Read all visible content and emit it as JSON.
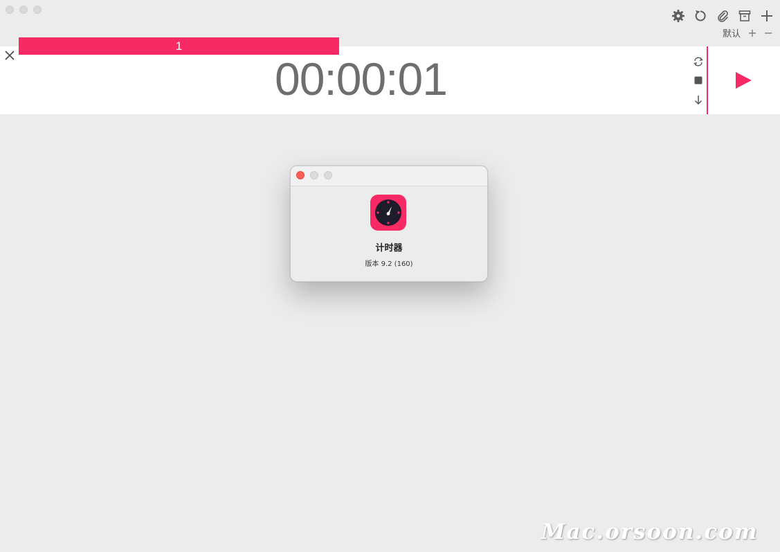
{
  "main_window": {
    "preset": {
      "label": "默认",
      "add_symbol": "+",
      "remove_symbol": "−"
    },
    "timer": {
      "label": "1",
      "time": "00:00:01"
    }
  },
  "about_dialog": {
    "app_name": "计时器",
    "version": "版本 9.2 (160)"
  },
  "watermark": "Mac.orsoon.com",
  "colors": {
    "accent": "#f72a65",
    "time_text": "#6e6e6e",
    "background": "#ececed"
  },
  "icons": {
    "toolbar": [
      "gear-icon",
      "reset-icon",
      "paperclip-icon",
      "archive-icon",
      "plus-icon"
    ],
    "timer_controls": [
      "repeat-icon",
      "stop-icon",
      "arrow-down-icon",
      "play-icon",
      "close-icon"
    ]
  }
}
